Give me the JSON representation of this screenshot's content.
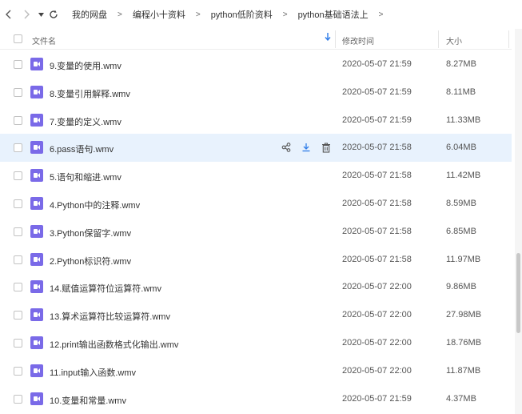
{
  "nav": {
    "back_icon": "chevron-left-icon",
    "forward_icon": "chevron-right-icon",
    "dropdown_icon": "caret-down-icon",
    "refresh_icon": "refresh-icon"
  },
  "breadcrumb": [
    "我的网盘",
    "编程小十资料",
    "python低阶资料",
    "python基础语法上"
  ],
  "columns": {
    "name": "文件名",
    "time": "修改时间",
    "size": "大小"
  },
  "colors": {
    "accent": "#2e7ce8",
    "file_icon": "#7a6ae8",
    "hover_row": "#e8f2fd"
  },
  "row_actions": [
    "share-icon",
    "download-icon",
    "delete-icon"
  ],
  "files": [
    {
      "name": "9.变量的使用.wmv",
      "time": "2020-05-07 21:59",
      "size": "8.27MB"
    },
    {
      "name": "8.变量引用解释.wmv",
      "time": "2020-05-07 21:59",
      "size": "8.11MB"
    },
    {
      "name": "7.变量的定义.wmv",
      "time": "2020-05-07 21:59",
      "size": "11.33MB"
    },
    {
      "name": "6.pass语句.wmv",
      "time": "2020-05-07 21:58",
      "size": "6.04MB",
      "hover": true
    },
    {
      "name": "5.语句和缩进.wmv",
      "time": "2020-05-07 21:58",
      "size": "11.42MB"
    },
    {
      "name": "4.Python中的注释.wmv",
      "time": "2020-05-07 21:58",
      "size": "8.59MB"
    },
    {
      "name": "3.Python保留字.wmv",
      "time": "2020-05-07 21:58",
      "size": "6.85MB"
    },
    {
      "name": "2.Python标识符.wmv",
      "time": "2020-05-07 21:58",
      "size": "11.97MB"
    },
    {
      "name": "14.赋值运算符位运算符.wmv",
      "time": "2020-05-07 22:00",
      "size": "9.86MB"
    },
    {
      "name": "13.算术运算符比较运算符.wmv",
      "time": "2020-05-07 22:00",
      "size": "27.98MB"
    },
    {
      "name": "12.print输出函数格式化输出.wmv",
      "time": "2020-05-07 22:00",
      "size": "18.76MB"
    },
    {
      "name": "11.input输入函数.wmv",
      "time": "2020-05-07 22:00",
      "size": "11.87MB"
    },
    {
      "name": "10.变量和常量.wmv",
      "time": "2020-05-07 21:59",
      "size": "4.37MB"
    }
  ]
}
